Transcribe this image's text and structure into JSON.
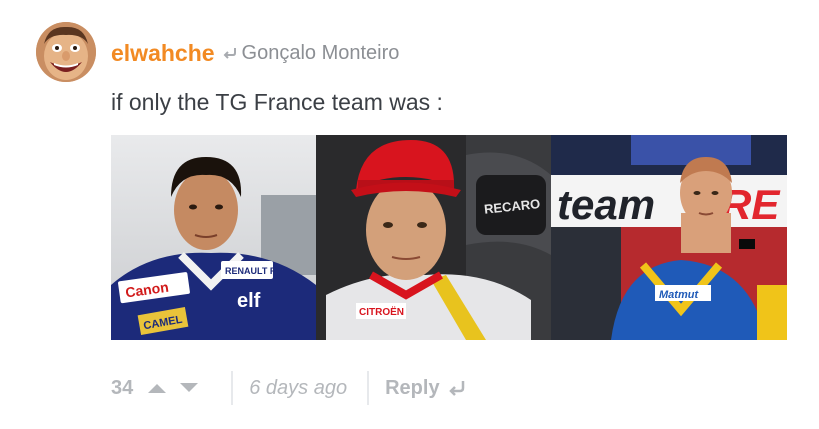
{
  "comment": {
    "username": "elwahche",
    "reply_to": "Gonçalo Monteiro",
    "text": "if only the TG France team was :",
    "photo_labels": {
      "photo1_sponsor": "Canon",
      "photo1_team": "RENAULT F1",
      "photo1_brand": "elf",
      "photo1_tobacco": "CAMEL",
      "photo2_seat": "RECARO",
      "photo2_sponsor": "CITROËN",
      "photo3_banner": "team",
      "photo3_banner_red": "RE",
      "photo3_sponsor": "Matmut"
    },
    "votes": "34",
    "timestamp": "6 days ago",
    "reply_label": "Reply"
  },
  "colors": {
    "username": "#f28a23",
    "meta": "#b4b7bb",
    "text": "#3b3f45"
  },
  "icons": {
    "reply_to": "reply-arrow-icon",
    "upvote": "upvote-icon",
    "downvote": "downvote-icon",
    "reply": "reply-arrow-icon"
  }
}
